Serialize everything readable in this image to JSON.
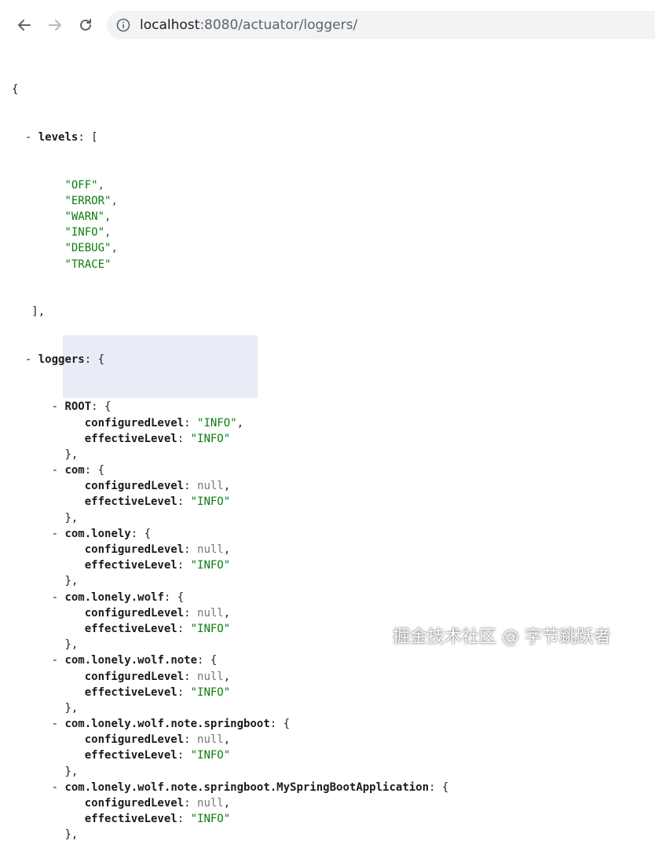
{
  "browser": {
    "url_host": "localhost",
    "url_rest": ":8080/actuator/loggers/"
  },
  "json": {
    "open_brace": "{",
    "levels_key": "levels",
    "levels": [
      "\"OFF\",",
      "\"ERROR\",",
      "\"WARN\",",
      "\"INFO\",",
      "\"DEBUG\",",
      "\"TRACE\""
    ],
    "levels_close": "],",
    "loggers_key": "loggers",
    "field_configured": "configuredLevel",
    "field_effective": "effectiveLevel",
    "loggers": [
      {
        "name": "ROOT",
        "configured": "\"INFO\"",
        "effective": "\"INFO\""
      },
      {
        "name": "com",
        "configured": "null",
        "effective": "\"INFO\""
      },
      {
        "name": "com.lonely",
        "configured": "null",
        "effective": "\"INFO\""
      },
      {
        "name": "com.lonely.wolf",
        "configured": "null",
        "effective": "\"INFO\""
      },
      {
        "name": "com.lonely.wolf.note",
        "configured": "null",
        "effective": "\"INFO\""
      },
      {
        "name": "com.lonely.wolf.note.springboot",
        "configured": "null",
        "effective": "\"INFO\""
      },
      {
        "name": "com.lonely.wolf.note.springboot.MySpringBootApplication",
        "configured": "null",
        "effective": "\"INFO\""
      }
    ],
    "collapse_glyph": "-"
  },
  "watermark": "掘金技术社区 @ 字节跳跃者",
  "colors": {
    "string": "#0a7d0a",
    "null": "#777777",
    "highlight": "#e9ecf7"
  }
}
